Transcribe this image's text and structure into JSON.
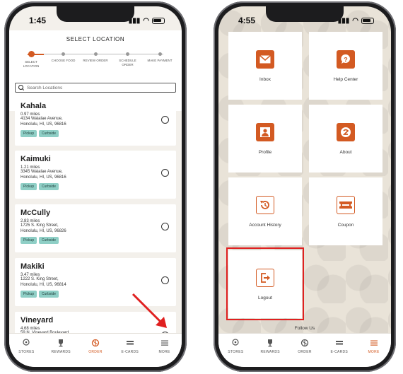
{
  "left_phone": {
    "time": "1:45",
    "title": "SELECT LOCATION",
    "steps": [
      {
        "label": "SELECT LOCATION",
        "active": true
      },
      {
        "label": "CHOOSE FOOD",
        "active": false
      },
      {
        "label": "REVIEW ORDER",
        "active": false
      },
      {
        "label": "SCHEDULE ORDER",
        "active": false
      },
      {
        "label": "MAKE PAYMENT",
        "active": false
      }
    ],
    "search_placeholder": "Search Locations",
    "locations": [
      {
        "name": "Kahala",
        "miles": "0.97 miles",
        "address1": "4134 Waialae Avenue,",
        "address2": "Honolulu, HI, US, 96816",
        "badges": [
          "Pickup",
          "Curbside"
        ]
      },
      {
        "name": "Kaimuki",
        "miles": "1.21 miles",
        "address1": "3345 Waialae Avenue,",
        "address2": "Honolulu, HI, US, 96816",
        "badges": [
          "Pickup",
          "Curbside"
        ]
      },
      {
        "name": "McCully",
        "miles": "2.83 miles",
        "address1": "1725 S. King Street,",
        "address2": "Honolulu, HI, US, 96826",
        "badges": [
          "Pickup",
          "Curbside"
        ]
      },
      {
        "name": "Makiki",
        "miles": "3.47 miles",
        "address1": "1222 S. King Street,",
        "address2": "Honolulu, HI, US, 96814",
        "badges": [
          "Pickup",
          "Curbside"
        ]
      },
      {
        "name": "Vineyard",
        "miles": "4.68 miles",
        "address1": "59 N. Vineyard Boulevard,",
        "address2": "",
        "badges": []
      }
    ]
  },
  "right_phone": {
    "time": "4:55",
    "menu": [
      {
        "label": "Inbox",
        "icon": "envelope-icon"
      },
      {
        "label": "Help Center",
        "icon": "question-icon"
      },
      {
        "label": "Profile",
        "icon": "person-icon"
      },
      {
        "label": "About",
        "icon": "about-icon"
      },
      {
        "label": "Account History",
        "icon": "history-icon"
      },
      {
        "label": "Coupon",
        "icon": "coupon-icon"
      },
      {
        "label": "Logout",
        "icon": "logout-icon"
      }
    ],
    "follow_us": "Follow Us"
  },
  "tabs": [
    {
      "label": "STORES",
      "icon": "location-pin-icon"
    },
    {
      "label": "REWARDS",
      "icon": "trophy-icon"
    },
    {
      "label": "ORDER",
      "icon": "order-icon"
    },
    {
      "label": "E-CARDS",
      "icon": "card-icon"
    },
    {
      "label": "MORE",
      "icon": "menu-icon"
    }
  ],
  "left_active_tab": "ORDER",
  "right_active_tab": "MORE",
  "colors": {
    "accent": "#d35a22",
    "badge": "#8fcfc6",
    "highlight": "#e02020"
  }
}
